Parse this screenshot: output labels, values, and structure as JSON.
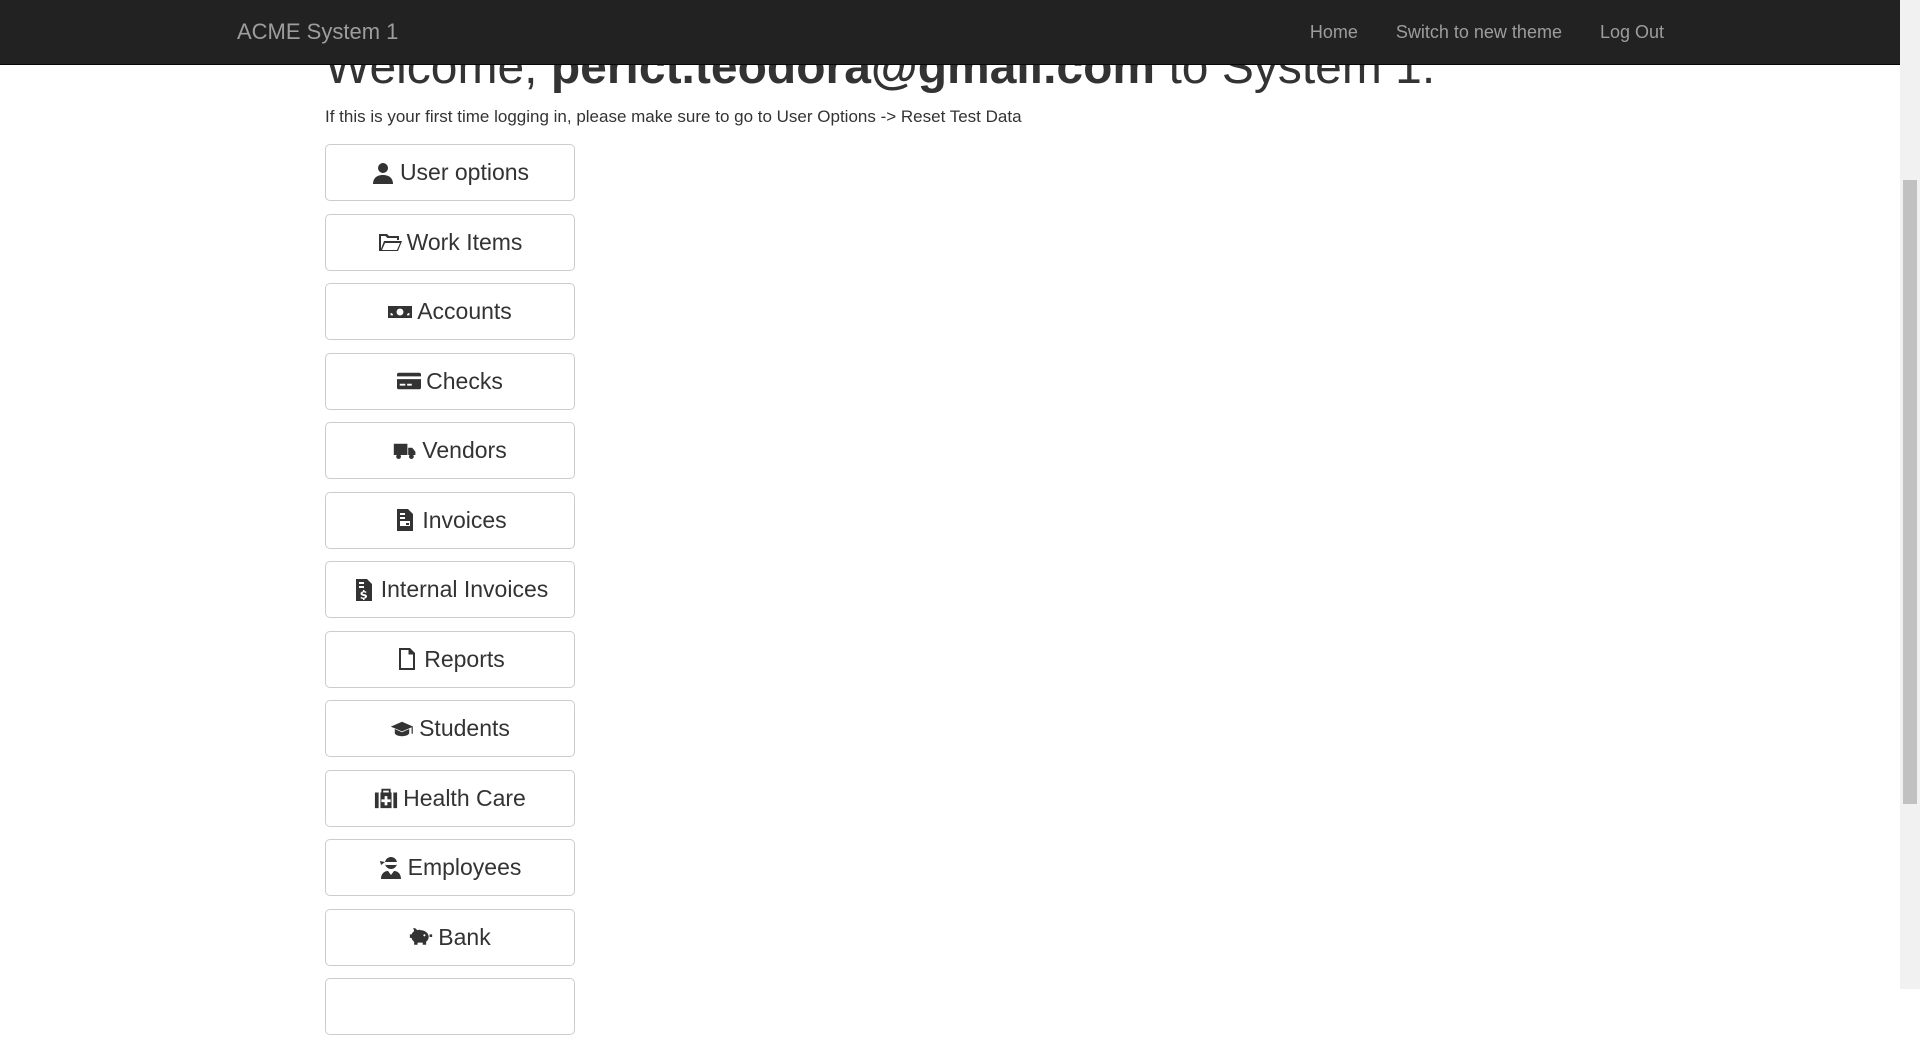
{
  "navbar": {
    "brand": "ACME System 1",
    "links": [
      "Home",
      "Switch to new theme",
      "Log Out"
    ]
  },
  "welcome": {
    "prefix": "Welcome, ",
    "user": "perict.teodora@gmail.com",
    "suffix": " to System 1."
  },
  "notice": "If this is your first time logging in, please make sure to go to User Options -> Reset Test Data",
  "menu": [
    {
      "label": "User options",
      "icon": "user-icon"
    },
    {
      "label": "Work Items",
      "icon": "folder-open-icon"
    },
    {
      "label": "Accounts",
      "icon": "money-bill-icon"
    },
    {
      "label": "Checks",
      "icon": "credit-card-icon"
    },
    {
      "label": "Vendors",
      "icon": "truck-icon"
    },
    {
      "label": "Invoices",
      "icon": "file-invoice-icon"
    },
    {
      "label": "Internal Invoices",
      "icon": "file-invoice-dollar-icon"
    },
    {
      "label": "Reports",
      "icon": "file-icon"
    },
    {
      "label": "Students",
      "icon": "graduation-cap-icon"
    },
    {
      "label": "Health Care",
      "icon": "medkit-icon"
    },
    {
      "label": "Employees",
      "icon": "user-ninja-icon"
    },
    {
      "label": "Bank",
      "icon": "piggy-bank-icon"
    }
  ]
}
